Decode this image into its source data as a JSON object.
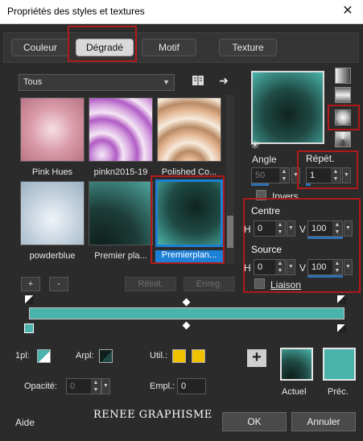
{
  "window": {
    "title": "Propriétés des styles et textures",
    "close_glyph": "✕"
  },
  "tabs": [
    {
      "label": "Couleur"
    },
    {
      "label": "Dégradé",
      "active": true
    },
    {
      "label": "Motif"
    },
    {
      "label": "Texture"
    }
  ],
  "gallery": {
    "filter": "Tous",
    "items": [
      {
        "label": "Pink Hues"
      },
      {
        "label": "pinkn2015-19"
      },
      {
        "label": "Polished Co..."
      },
      {
        "label": "powderblue"
      },
      {
        "label": "Premier pla..."
      },
      {
        "label": "Premierplan...",
        "selected": true
      }
    ],
    "add_label": "+",
    "remove_label": "-",
    "reset_label": "Réinit.",
    "save_label": "Enreg."
  },
  "params": {
    "angle_label": "Angle",
    "angle_value": "50",
    "repeat_label": "Répét.",
    "repeat_value": "1",
    "invert_label": "Invers",
    "center_label": "Centre",
    "center_h": "0",
    "center_v": "100",
    "source_label": "Source",
    "source_h": "0",
    "source_v": "100",
    "h_label": "H",
    "v_label": "V",
    "link_label": "Liaison"
  },
  "bottom": {
    "opl_label": "1pl:",
    "arpl_label": "Arpl:",
    "util_label": "Util.:",
    "opacity_label": "Opacité:",
    "opacity_value": "0",
    "empl_label": "Empl.:",
    "empl_value": "0",
    "current_label": "Actuel",
    "previous_label": "Préc."
  },
  "footer": {
    "help_label": "Aide",
    "watermark": "RENEE GRAPHISME",
    "ok_label": "OK",
    "cancel_label": "Annuler"
  },
  "colors": {
    "teal": "#4ab4ac",
    "dark_teal": "#1f4a43",
    "yellow": "#f2c200",
    "highlight_red": "#b01a1a",
    "selection_blue": "#1c7fd6"
  }
}
